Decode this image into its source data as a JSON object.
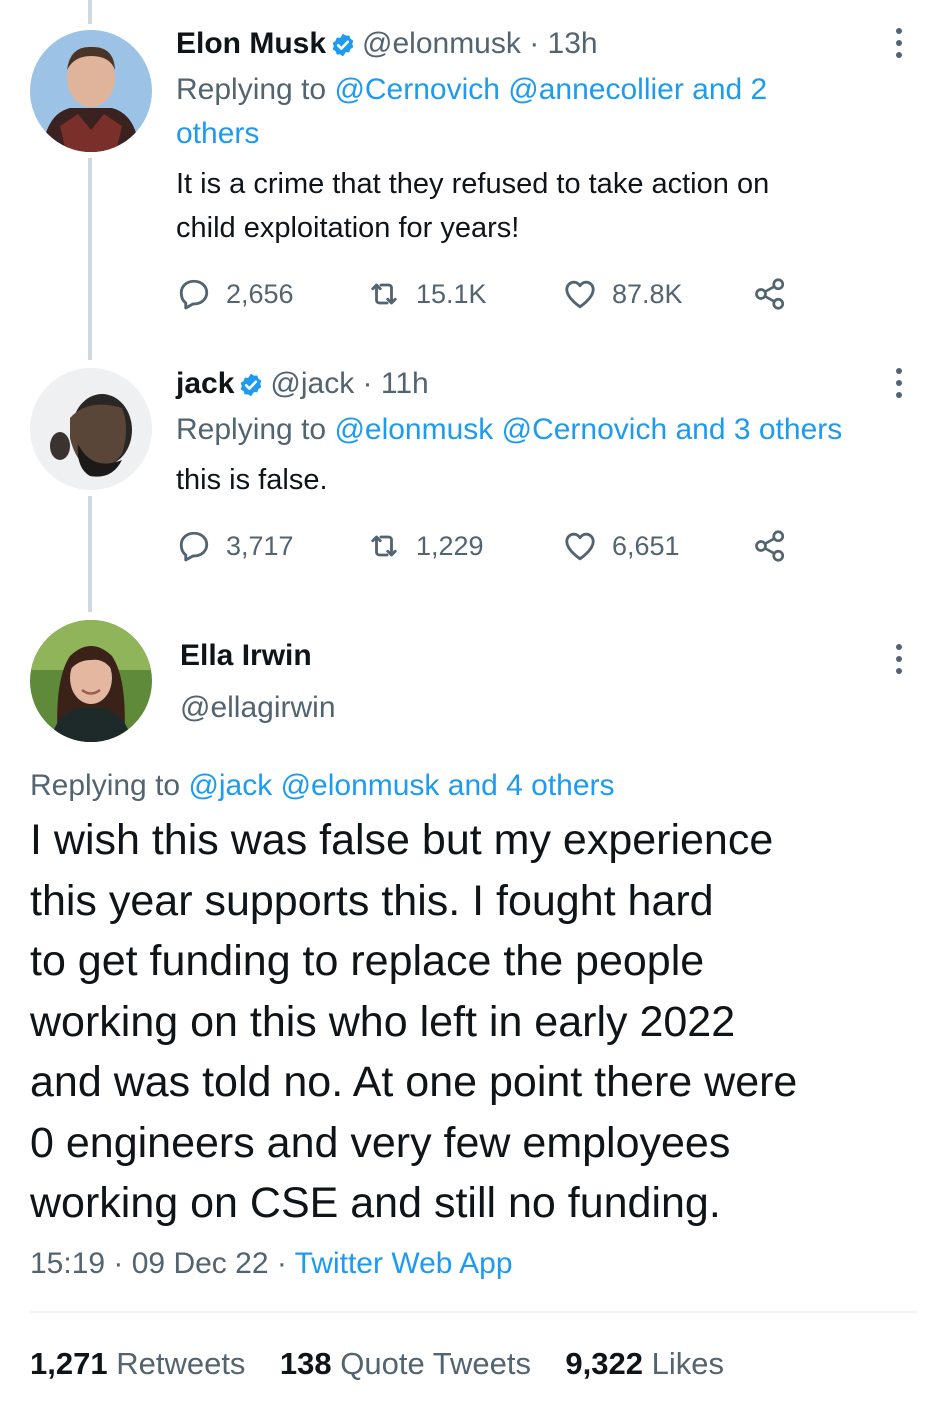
{
  "tweets": [
    {
      "name": "Elon Musk",
      "handle": "@elonmusk",
      "time": "13h",
      "replying_label": "Replying to",
      "replying_to": "@Cernovich @annecollier and 2",
      "replying_to_2": "others",
      "text_line1": "It is a crime that they refused to take action on",
      "text_line2": "child exploitation for years!",
      "replies": "2,656",
      "retweets": "15.1K",
      "likes": "87.8K"
    },
    {
      "name": "jack",
      "handle": "@jack",
      "time": "11h",
      "replying_label": "Replying to",
      "replying_to": "@elonmusk @Cernovich and 3 others",
      "text_line1": "this is false.",
      "replies": "3,717",
      "retweets": "1,229",
      "likes": "6,651"
    }
  ],
  "main_tweet": {
    "name": "Ella Irwin",
    "handle": "@ellagirwin",
    "replying_label": "Replying to",
    "replying_to": "@jack @elonmusk and 4 others",
    "text_lines": [
      "I wish this was false but my experience",
      "this year supports this. I fought hard",
      "to get funding to replace the people",
      "working on this who left in early 2022",
      "and was told no. At one point there were",
      "0 engineers and very few employees",
      "working on CSE and still no funding."
    ],
    "time": "15:19",
    "date": "09 Dec 22",
    "source": "Twitter Web App",
    "retweets_count": "1,271",
    "retweets_label": "Retweets",
    "quotes_count": "138",
    "quotes_label": "Quote Tweets",
    "likes_count": "9,322",
    "likes_label": "Likes"
  },
  "icons": {
    "verified": "verified-badge-icon",
    "reply": "reply-bubble-icon",
    "retweet": "retweet-arrows-icon",
    "like": "heart-icon",
    "share": "share-icon",
    "more": "more-vertical-icon"
  },
  "colors": {
    "link": "#1d9bf0",
    "muted": "#536471",
    "text": "#0f1419",
    "thread_line": "#cfd9de"
  }
}
